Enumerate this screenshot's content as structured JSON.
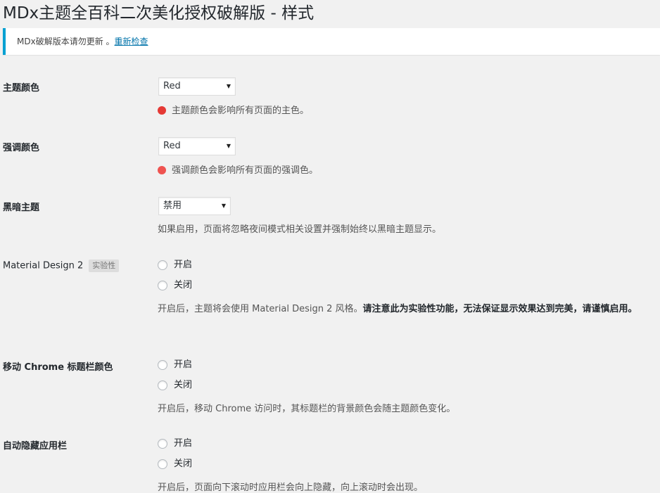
{
  "page": {
    "title": "MDx主题全百科二次美化授权破解版 - 样式"
  },
  "notice": {
    "text": "MDx破解版本请勿更新 。",
    "link": "重新检查"
  },
  "fields": {
    "theme_color": {
      "label": "主题颜色",
      "value": "Red",
      "desc": "主题颜色会影响所有页面的主色。",
      "swatch": "#e53935"
    },
    "accent_color": {
      "label": "强调颜色",
      "value": "Red",
      "desc": "强调颜色会影响所有页面的强调色。",
      "swatch": "#ef5350"
    },
    "dark_theme": {
      "label": "黑暗主题",
      "value": "禁用",
      "desc": "如果启用，页面将忽略夜间模式相关设置并强制始终以黑暗主题显示。"
    },
    "md2": {
      "label": "Material Design 2",
      "badge": "实验性",
      "opt_on": "开启",
      "opt_off": "关闭",
      "desc_prefix": "开启后，主题将会使用 Material Design 2 风格。",
      "desc_warning": "请注意此为实验性功能，无法保证显示效果达到完美，请谨慎启用。"
    },
    "chrome_color": {
      "label": "移动 Chrome 标题栏颜色",
      "opt_on": "开启",
      "opt_off": "关闭",
      "desc": "开启后，移动 Chrome 访问时，其标题栏的背景颜色会随主题颜色变化。"
    },
    "autohide_bar": {
      "label": "自动隐藏应用栏",
      "opt_on": "开启",
      "opt_off": "关闭",
      "desc": "开启后，页面向下滚动时应用栏会向上隐藏，向上滚动时会出现。"
    }
  },
  "icons": {
    "select_arrow": "▼"
  }
}
